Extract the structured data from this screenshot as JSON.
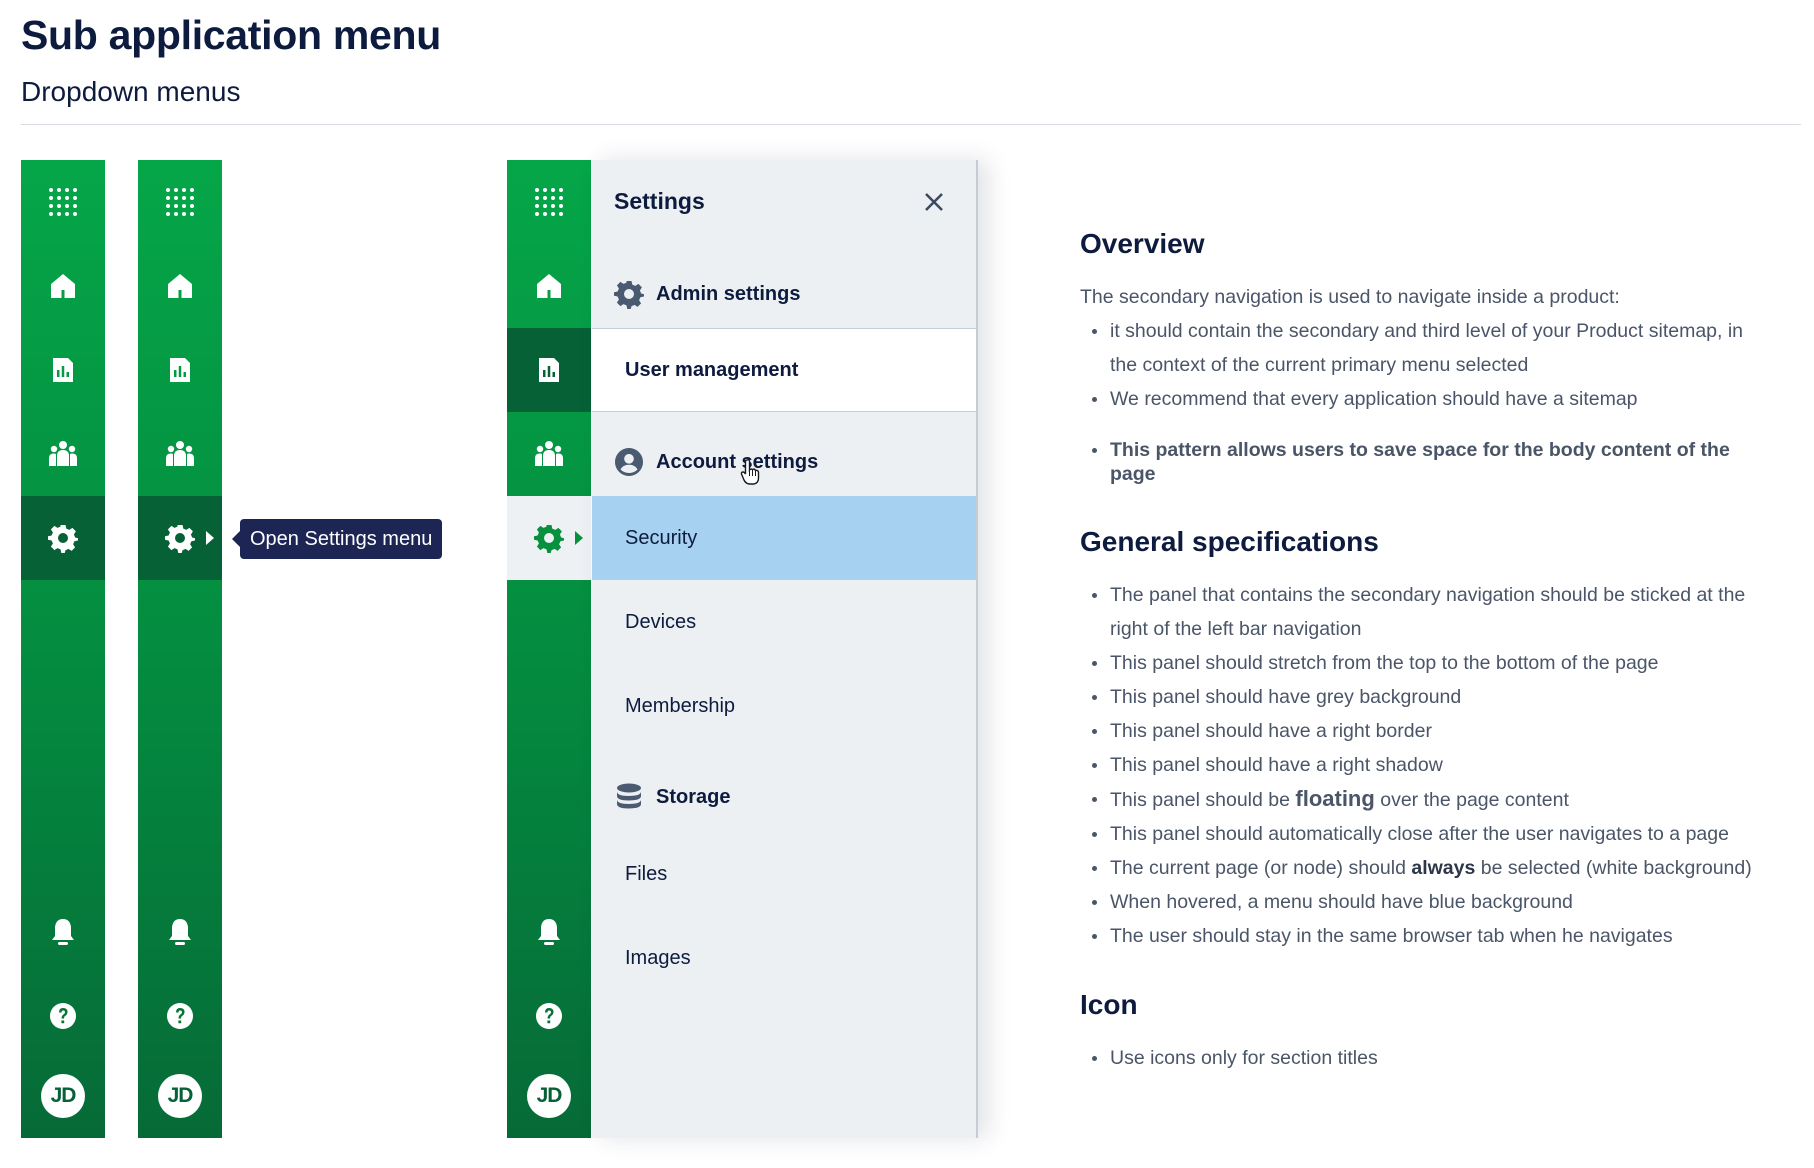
{
  "header": {
    "title": "Sub application menu",
    "subtitle": "Dropdown menus"
  },
  "nav": {
    "avatar_initials": "JD",
    "items": [
      "apps-grid-icon",
      "home-icon",
      "report-icon",
      "team-icon",
      "settings-icon",
      "bell-icon",
      "help-icon"
    ]
  },
  "tooltip": {
    "text": "Open Settings menu"
  },
  "panel": {
    "title": "Settings",
    "sections": [
      {
        "title": "Admin settings",
        "icon": "gear-icon",
        "items": [
          "User management"
        ]
      },
      {
        "title": "Account settings",
        "icon": "user-circle-icon",
        "items": [
          "Security",
          "Devices",
          "Membership"
        ]
      },
      {
        "title": "Storage",
        "icon": "database-icon",
        "items": [
          "Files",
          "Images"
        ]
      }
    ],
    "selected_item": "User management",
    "hovered_item": "Security"
  },
  "doc": {
    "overview_title": "Overview",
    "overview_intro": "The secondary navigation is used to navigate inside a product:",
    "overview_items": [
      "it should contain the secondary and third level of your Product sitemap, in the context of the current primary menu selected",
      "We recommend that every application should have a sitemap"
    ],
    "overview_strong": "This pattern allows users to save space for the body content of the page",
    "spec_title": "General specifications",
    "spec_items": [
      "The panel that contains the secondary navigation should be sticked at the right of the left bar navigation",
      "This panel should stretch from the top to the bottom of the page",
      "This panel should have grey background",
      "This panel should have a right border",
      "This panel should have a right shadow"
    ],
    "spec_floating_before": "This panel should be ",
    "spec_floating_bold": "floating",
    "spec_floating_after": " over the page content",
    "spec_items_2": [
      "This panel should automatically close after the user navigates to a page"
    ],
    "spec_always_before": "The current page (or node) should ",
    "spec_always_bold": "always",
    "spec_always_after": " be selected (white background)",
    "spec_items_3": [
      "When hovered, a menu should have blue background",
      "The user should stay in the same browser tab when he navigates"
    ],
    "icon_title": "Icon",
    "icon_items": [
      "Use icons only for section titles"
    ]
  },
  "colors": {
    "nav_green_top": "#05a648",
    "nav_green_bottom": "#066a37",
    "nav_active": "#066137",
    "panel_bg": "#edf0f3",
    "hover_blue": "#a6d1f0",
    "tooltip_bg": "#1c2554"
  }
}
